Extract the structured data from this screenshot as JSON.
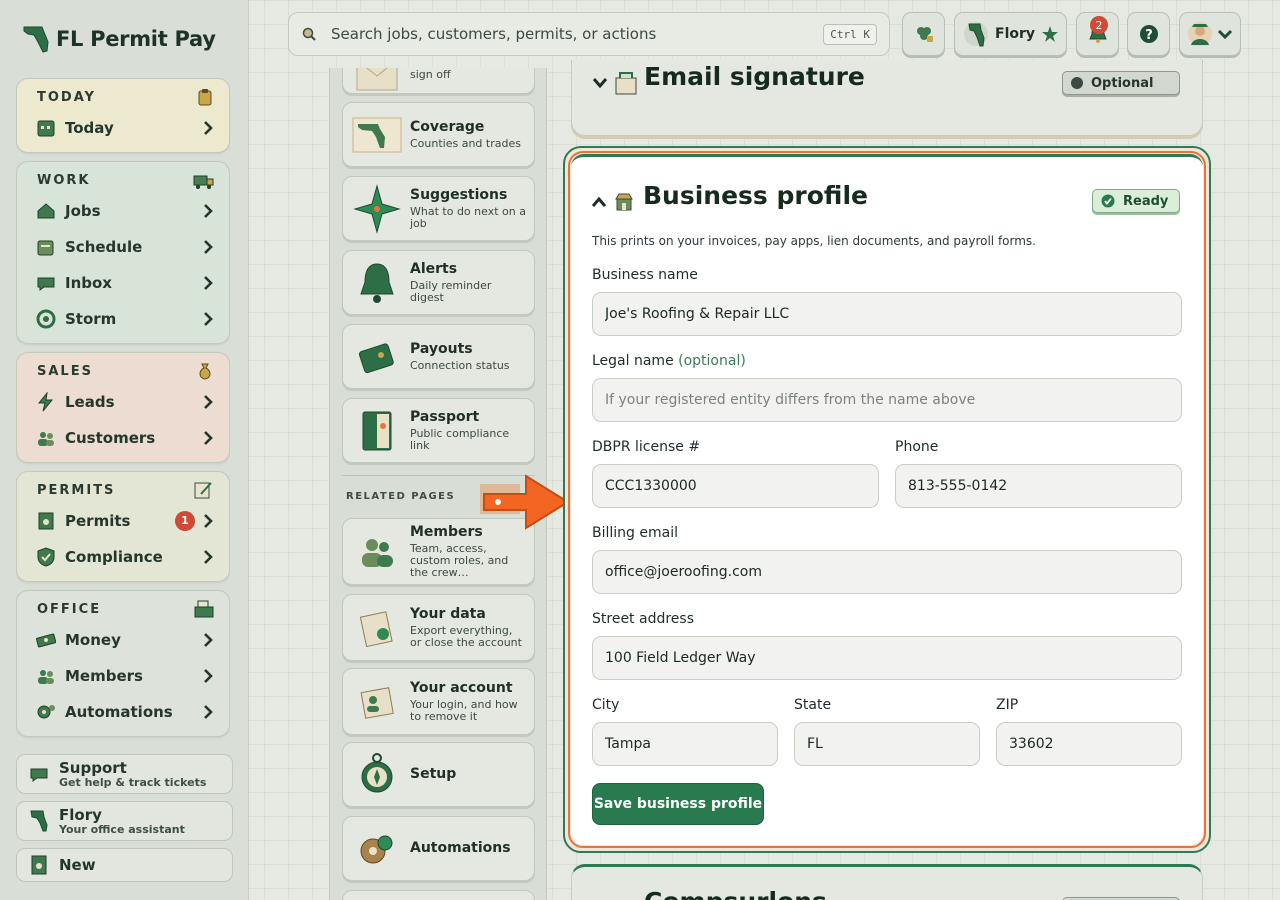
{
  "brand": {
    "name": "FL Permit Pay"
  },
  "search": {
    "placeholder": "Search jobs, customers, permits, or actions",
    "shortcut": "Ctrl K"
  },
  "topbar": {
    "assistant_name": "Flory",
    "notification_count": "2"
  },
  "sidebar": {
    "groups": [
      {
        "title": "TODAY",
        "items": [
          {
            "label": "Today"
          }
        ]
      },
      {
        "title": "WORK",
        "items": [
          {
            "label": "Jobs"
          },
          {
            "label": "Schedule"
          },
          {
            "label": "Inbox"
          },
          {
            "label": "Storm"
          }
        ]
      },
      {
        "title": "SALES",
        "items": [
          {
            "label": "Leads"
          },
          {
            "label": "Customers"
          }
        ]
      },
      {
        "title": "PERMITS",
        "items": [
          {
            "label": "Permits",
            "badge": "1"
          },
          {
            "label": "Compliance"
          }
        ]
      },
      {
        "title": "OFFICE",
        "items": [
          {
            "label": "Money"
          },
          {
            "label": "Members"
          },
          {
            "label": "Automations"
          }
        ]
      }
    ],
    "bottom": [
      {
        "title": "Support",
        "subtitle": "Get help & track tickets"
      },
      {
        "title": "Flory",
        "subtitle": "Your office assistant"
      },
      {
        "title": "New"
      }
    ]
  },
  "settings_nav": {
    "items": [
      {
        "title": "",
        "subtitle": "sign off"
      },
      {
        "title": "Coverage",
        "subtitle": "Counties and trades"
      },
      {
        "title": "Suggestions",
        "subtitle": "What to do next on a job"
      },
      {
        "title": "Alerts",
        "subtitle": "Daily reminder digest"
      },
      {
        "title": "Payouts",
        "subtitle": "Connection status"
      },
      {
        "title": "Passport",
        "subtitle": "Public compliance link"
      }
    ],
    "related_heading": "RELATED PAGES",
    "related": [
      {
        "title": "Members",
        "subtitle": "Team, access, custom roles, and the crew…"
      },
      {
        "title": "Your data",
        "subtitle": "Export everything, or close the account"
      },
      {
        "title": "Your account",
        "subtitle": "Your login, and how to remove it"
      },
      {
        "title": "Setup"
      },
      {
        "title": "Automations"
      }
    ]
  },
  "email_signature": {
    "title": "Email signature",
    "status": "Optional"
  },
  "business_profile": {
    "title": "Business profile",
    "status": "Ready",
    "description": "This prints on your invoices, pay apps, lien documents, and payroll forms.",
    "fields": {
      "business_name": {
        "label": "Business name",
        "value": "Joe's Roofing & Repair LLC"
      },
      "legal_name": {
        "label": "Legal name",
        "label_suffix": "(optional)",
        "value": "",
        "placeholder": "If your registered entity differs from the name above"
      },
      "dbpr": {
        "label": "DBPR license #",
        "value": "CCC1330000"
      },
      "phone": {
        "label": "Phone",
        "value": "813-555-0142"
      },
      "billing_email": {
        "label": "Billing email",
        "value": "office@joeroofing.com"
      },
      "street": {
        "label": "Street address",
        "value": "100 Field Ledger Way"
      },
      "city": {
        "label": "City",
        "value": "Tampa"
      },
      "state": {
        "label": "State",
        "value": "FL"
      },
      "zip": {
        "label": "ZIP",
        "value": "33602"
      }
    },
    "save_label": "Save business profile"
  },
  "next_section": {
    "title": "Compsurlons"
  },
  "colors": {
    "accent_green": "#2a7a50",
    "highlight_orange": "#e9733d",
    "badge_red": "#cf4b35"
  }
}
